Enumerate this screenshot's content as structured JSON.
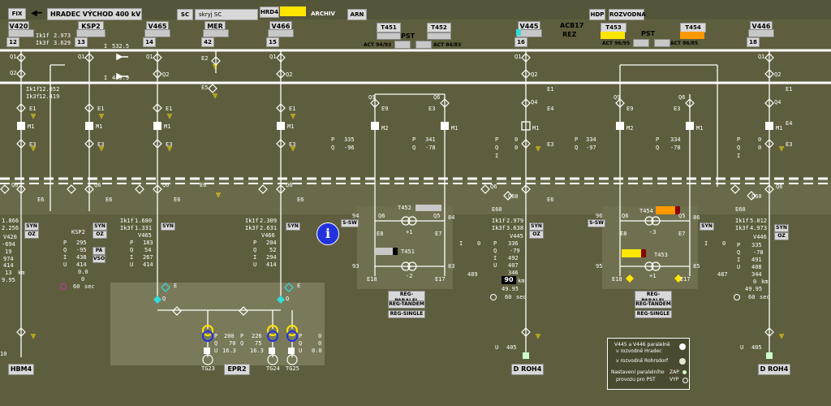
{
  "topbar": {
    "fix": "FIX",
    "title": "HRADEC VÝCHOD 400 kV",
    "sc_btn": "SC",
    "skryj_sc": "skryj SC",
    "hrd4": "HRD4",
    "archiv": "ARCHIV",
    "arn": "ARN",
    "hdp": "HDP",
    "rozvodna": "ROZVODNA"
  },
  "feeders_top": [
    {
      "name": "V420",
      "num": "12",
      "ik1": "2.973",
      "ik3": "3.629"
    },
    {
      "name": "KSP2",
      "num": "13",
      "ik1": "",
      "ik3": ""
    },
    {
      "name": "V465",
      "num": "14"
    },
    {
      "name": "MER",
      "num": "42"
    },
    {
      "name": "V466",
      "num": "15"
    },
    {
      "name": "V445",
      "num": "16"
    },
    {
      "name": "V446",
      "num": "18"
    }
  ],
  "top_labels": {
    "t451": "T451",
    "t452": "T452",
    "pst1": "PST",
    "act_94_93": "ACT 94/93",
    "act_84_83": "ACT 84/83",
    "acb17": "ACB17",
    "rez": "REZ",
    "t453": "T453",
    "t454": "T454",
    "pst2": "PST",
    "act_96_95": "ACT 96/95",
    "act_86_85": "ACT 86/85",
    "ik1": "Ik1f",
    "ik3": "Ik3f"
  },
  "bus": {
    "b1_label": "I",
    "b1_val": "532.5",
    "b2_label": "I",
    "b2_val": "449.9",
    "ik1_val": "12.052",
    "ik3_val": "12.419"
  },
  "switch_labels": {
    "q1": "Q1",
    "q2": "Q2",
    "q9": "Q9",
    "q6": "Q6",
    "q4": "Q4",
    "e1": "E1",
    "e3": "E3",
    "e4": "E4",
    "e6": "E6",
    "e9": "E9",
    "m1": "M1",
    "m2": "M2",
    "e60": "E60",
    "q60": "Q60",
    "e2": "E2",
    "e5": "E5",
    "e": "E",
    "q": "Q"
  },
  "pq": [
    {
      "p": "335",
      "q": "-96"
    },
    {
      "p": "341",
      "q": "-78"
    },
    {
      "p": "0",
      "q": "0"
    },
    {
      "p": "334",
      "q": "-97"
    },
    {
      "p": "334",
      "q": "-78"
    },
    {
      "p": "0",
      "q": "0"
    }
  ],
  "pq_labels": {
    "p": "P",
    "q": "Q",
    "i": "I"
  },
  "panels": {
    "v420": {
      "ik1": "1.866",
      "ik3": "2.256",
      "name": "V420",
      "p": "-694",
      "q": "19",
      "i": "974",
      "u": "414",
      "l": "13",
      "extra": "9.95",
      "km": "km"
    },
    "ksp2": {
      "name": "KSP2",
      "p": "295",
      "q": "-95",
      "i": "438",
      "u": "414",
      "a": "0.0",
      "l": "0",
      "t": "60",
      "sec": "sec",
      "pa": "PA",
      "vso": "VSO",
      "syn": "SYN"
    },
    "v465": {
      "ik1": "1.680",
      "ik3": "1.331",
      "name": "V465",
      "p": "183",
      "q": "54",
      "i": "267",
      "u": "414",
      "syn": "SYN"
    },
    "v466": {
      "ik1": "2.309",
      "ik3": "2.631",
      "name": "V466",
      "p": "204",
      "q": "52",
      "i": "294",
      "u": "414",
      "syn": "SYN"
    },
    "v445": {
      "ik1": "2.979",
      "ik3": "3.638",
      "name": "V445",
      "p": "336",
      "q": "-79",
      "i": "492",
      "u": "407",
      "s": "346",
      "l": "90",
      "km": "km",
      "extra": "49.95",
      "t": "60",
      "sec": "sec",
      "i_left": "489",
      "syn": "SYN",
      "oz": "OZ"
    },
    "v446": {
      "ik1": "5.012",
      "ik3": "4.973",
      "name": "V446",
      "p": "335",
      "q": "-78",
      "i": "491",
      "u": "408",
      "s": "344",
      "l": "0",
      "km": "km",
      "extra": "49.95",
      "t": "60",
      "sec": "sec",
      "i_left": "487",
      "syn": "SYN",
      "oz": "OZ"
    },
    "ksw_left": {
      "label": "S-SW",
      "t452": "T452",
      "t451": "T451",
      "n94": "94",
      "n84": "84",
      "n93": "93",
      "n83": "83",
      "p1": "+1",
      "m2": "-2",
      "q6": "Q6",
      "q5": "Q5",
      "e8": "E8",
      "e7": "E7",
      "e18": "E18",
      "e17": "E17",
      "i": "I",
      "i_val": "0"
    },
    "ksw_right": {
      "label": "S-SW",
      "t454": "T454",
      "t453": "T453",
      "n96": "96",
      "n86": "86",
      "n95": "95",
      "n85": "85",
      "m3": "-3",
      "p1": "+1",
      "q6": "Q6",
      "q5": "Q5",
      "e8": "E8",
      "e7": "E7",
      "e18": "E18",
      "e17": "E17",
      "i": "I",
      "i_val": "0"
    },
    "epr2": {
      "p": "200",
      "q": "70",
      "u": "16.3",
      "p2": "226",
      "q2": "75",
      "u2": "16.3",
      "z1": "0",
      "z2": "0",
      "z3": "0.0"
    }
  },
  "reg_buttons": [
    "REG-PARALEL",
    "REG-TANDEM",
    "REG-SINGLE"
  ],
  "bottom_names": {
    "hbm4": "HBM4",
    "epr2": "EPR2",
    "droh4_a": "D ROH4",
    "droh4_b": "D ROH4",
    "tg23": "TG23",
    "tg24": "TG24",
    "tg25": "TG25"
  },
  "bottom_u": {
    "u_label": "U",
    "u1": "405",
    "u2": "405",
    "left_num": "10"
  },
  "legend": {
    "line1": "V445 a V446 paralelně",
    "line2": "v rozvodně Hradec",
    "line3": "v rozvodně Rohrsdorf",
    "line4": "Nastavení paralelního",
    "line5": "provozu pro PST",
    "zap": "ZAP",
    "vyp": "VYP"
  },
  "info_icon": "i",
  "colors": {
    "bg": "#5e5e3e",
    "panel": "#6b6b4f",
    "bus": "#ffffff",
    "yellow": "#ffe600",
    "orange": "#ff9900",
    "cyan": "#33dddd",
    "blue": "#2233dd"
  }
}
